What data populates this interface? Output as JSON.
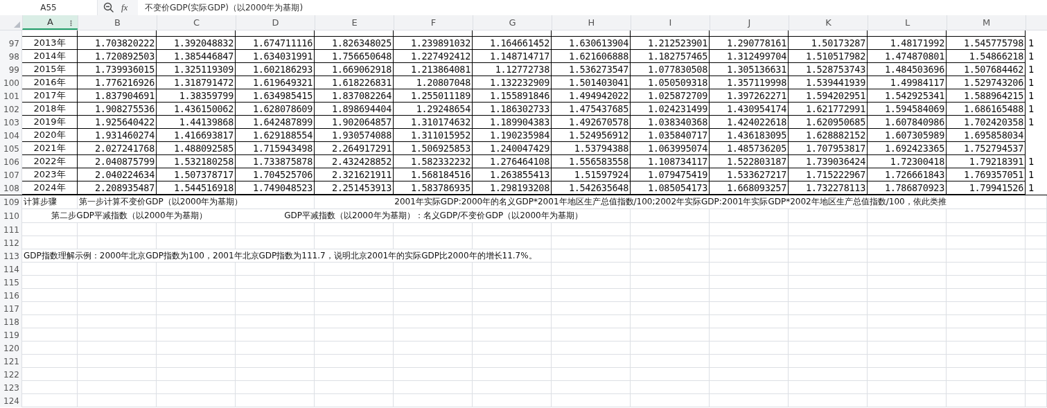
{
  "formula_bar": {
    "name_box": "A55",
    "function_label": "fx",
    "formula": "不变价GDP(实际GDP)（以2000年为基期)"
  },
  "columns": [
    {
      "label": "A",
      "selected": true
    },
    {
      "label": "B",
      "selected": false
    },
    {
      "label": "C",
      "selected": false
    },
    {
      "label": "D",
      "selected": false
    },
    {
      "label": "E",
      "selected": false
    },
    {
      "label": "F",
      "selected": false
    },
    {
      "label": "G",
      "selected": false
    },
    {
      "label": "H",
      "selected": false
    },
    {
      "label": "I",
      "selected": false
    },
    {
      "label": "J",
      "selected": false
    },
    {
      "label": "K",
      "selected": false
    },
    {
      "label": "L",
      "selected": false
    },
    {
      "label": "M",
      "selected": false
    }
  ],
  "data_rows": [
    {
      "number": "97",
      "year": "2013年",
      "values": [
        "1.703820222",
        "1.392048832",
        "1.674711116",
        "1.826348025",
        "1.239891032",
        "1.164661452",
        "1.630613904",
        "1.212523901",
        "1.290778161",
        "1.50173287",
        "1.48171992",
        "1.545775798"
      ],
      "column_14": "1"
    },
    {
      "number": "98",
      "year": "2014年",
      "values": [
        "1.720892503",
        "1.385446847",
        "1.634031991",
        "1.756650648",
        "1.227492412",
        "1.148714717",
        "1.621606888",
        "1.182757465",
        "1.312499704",
        "1.510517982",
        "1.474870801",
        "1.54866218"
      ],
      "column_14": "1"
    },
    {
      "number": "99",
      "year": "2015年",
      "values": [
        "1.739936015",
        "1.325119309",
        "1.602186293",
        "1.669062918",
        "1.213864081",
        "1.12772738",
        "1.536273547",
        "1.077830508",
        "1.305136631",
        "1.528753743",
        "1.484503696",
        "1.507684462"
      ],
      "column_14": "1"
    },
    {
      "number": "100",
      "year": "2016年",
      "values": [
        "1.776216926",
        "1.318791472",
        "1.619649321",
        "1.618226831",
        "1.20807048",
        "1.132232909",
        "1.501403041",
        "1.050509318",
        "1.357119998",
        "1.539441939",
        "1.49984117",
        "1.529743206"
      ],
      "column_14": "1"
    },
    {
      "number": "101",
      "year": "2017年",
      "values": [
        "1.837904691",
        "1.38359799",
        "1.634985415",
        "1.837082264",
        "1.255011189",
        "1.155891846",
        "1.494942022",
        "1.025872709",
        "1.397262271",
        "1.594202951",
        "1.542925341",
        "1.588964215"
      ],
      "column_14": "1"
    },
    {
      "number": "102",
      "year": "2018年",
      "values": [
        "1.908275536",
        "1.436150062",
        "1.628078609",
        "1.898694404",
        "1.29248654",
        "1.186302733",
        "1.475437685",
        "1.024231499",
        "1.430954174",
        "1.621772991",
        "1.594584069",
        "1.686165488"
      ],
      "column_14": "1"
    },
    {
      "number": "103",
      "year": "2019年",
      "values": [
        "1.925640422",
        "1.44139868",
        "1.642487899",
        "1.902064857",
        "1.310174632",
        "1.189904383",
        "1.492670578",
        "1.038340368",
        "1.424022618",
        "1.620950685",
        "1.607840986",
        "1.702420358"
      ],
      "column_14": "1"
    },
    {
      "number": "104",
      "year": "2020年",
      "values": [
        "1.931460274",
        "1.416693817",
        "1.629188554",
        "1.930574088",
        "1.311015952",
        "1.190235984",
        "1.524956912",
        "1.035840717",
        "1.436183095",
        "1.628882152",
        "1.607305989",
        "1.695858034"
      ]
    },
    {
      "number": "105",
      "year": "2021年",
      "values": [
        "2.027241768",
        "1.488092585",
        "1.715943498",
        "2.264917291",
        "1.506925853",
        "1.240047429",
        "1.53794388",
        "1.063995074",
        "1.485736205",
        "1.707953817",
        "1.692423365",
        "1.752794537"
      ]
    },
    {
      "number": "106",
      "year": "2022年",
      "values": [
        "2.040875799",
        "1.532180258",
        "1.733875878",
        "2.432428852",
        "1.582332232",
        "1.276464108",
        "1.556583558",
        "1.108734117",
        "1.522803187",
        "1.739036424",
        "1.72300418",
        "1.79218391"
      ],
      "column_14": "1"
    },
    {
      "number": "107",
      "year": "2023年",
      "values": [
        "2.040224634",
        "1.507378717",
        "1.704525706",
        "2.321621911",
        "1.568184516",
        "1.263855413",
        "1.51597924",
        "1.079475419",
        "1.533627217",
        "1.715222967",
        "1.726661843",
        "1.769357051"
      ],
      "column_14": "1"
    },
    {
      "number": "108",
      "year": "2024年",
      "values": [
        "2.208935487",
        "1.544516918",
        "1.749048523",
        "2.251453913",
        "1.583786935",
        "1.298193208",
        "1.542635648",
        "1.085054173",
        "1.668093257",
        "1.732278113",
        "1.786870923",
        "1.79941526"
      ],
      "column_14": "1"
    }
  ],
  "lower_rows": [
    {
      "number": "109",
      "column_a": "计算步骤",
      "column_b": "第一步计算不变价GDP（以2000年为基期）",
      "column_e": "2001年实际GDP:2000年的名义GDP*2001年地区生产总值指数/100;2002年实际GDP:2001年实际GDP*2002年地区生产总值指数/100，依此类推"
    },
    {
      "number": "110",
      "column_a": "第二步GDP平减指数（以2000年为基期）",
      "column_d": "GDP平减指数（以2000年为基期）：名义GDP/不变价GDP（以2000年为基期）"
    },
    {
      "number": "111"
    },
    {
      "number": "112"
    },
    {
      "number": "113",
      "column_a": "GDP指数理解示例：2000年北京GDP指数为100，2001年北京GDP指数为111.7，说明北京2001年的实际GDP比2000年的增长11.7%。"
    },
    {
      "number": "114"
    },
    {
      "number": "115"
    },
    {
      "number": "116"
    },
    {
      "number": "117"
    },
    {
      "number": "118"
    },
    {
      "number": "119"
    },
    {
      "number": "120"
    },
    {
      "number": "121"
    },
    {
      "number": "122"
    },
    {
      "number": "123"
    },
    {
      "number": "124"
    }
  ]
}
